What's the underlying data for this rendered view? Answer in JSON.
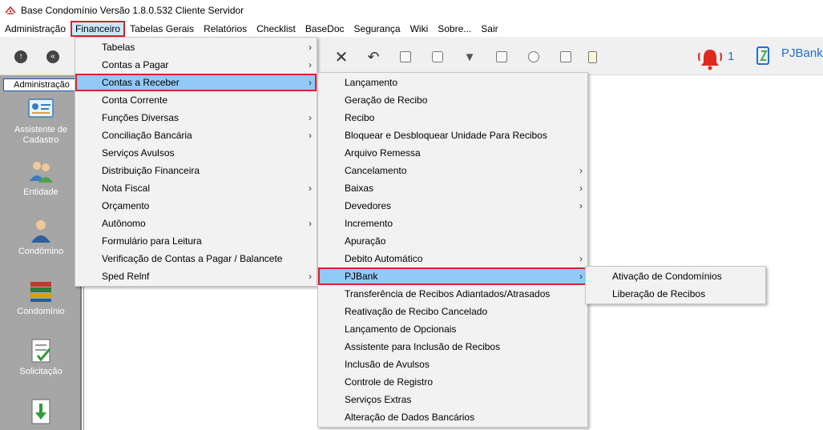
{
  "window": {
    "title": "Base Condomínio Versão 1.8.0.532 Cliente Servidor"
  },
  "menubar": [
    "Administração",
    "Financeiro",
    "Tabelas Gerais",
    "Relatórios",
    "Checklist",
    "BaseDoc",
    "Segurança",
    "Wiki",
    "Sobre...",
    "Sair"
  ],
  "toolbar": {
    "notification_count": "1",
    "pjbank_label": "PJBank",
    "icons": [
      "up-arrow-icon",
      "back-arrow-icon",
      "close-x-icon",
      "undo-icon",
      "save-icon",
      "print-icon",
      "filter-icon",
      "window-icon",
      "search-icon",
      "zoom-icon",
      "notepad-icon",
      "bell-icon",
      "pjbank-logo-icon"
    ],
    "bell_color": "#e0281f",
    "accent_color": "#1f6fd6"
  },
  "sidebar": {
    "tab": "Administração",
    "items": [
      {
        "label": "Assistente de Cadastro",
        "icon": "id-card-icon"
      },
      {
        "label": "Entidade",
        "icon": "people-icon"
      },
      {
        "label": "Condômino",
        "icon": "person-icon"
      },
      {
        "label": "Condomínio",
        "icon": "books-icon"
      },
      {
        "label": "Solicitação",
        "icon": "checklist-icon"
      },
      {
        "label": "",
        "icon": "download-document-icon"
      }
    ]
  },
  "financeiro_menu": [
    {
      "label": "Tabelas",
      "submenu": true
    },
    {
      "label": "Contas a Pagar",
      "submenu": true
    },
    {
      "label": "Contas a Receber",
      "submenu": true,
      "selected": true
    },
    {
      "label": "Conta Corrente",
      "submenu": false
    },
    {
      "label": "Funções Diversas",
      "submenu": true
    },
    {
      "label": "Conciliação Bancária",
      "submenu": true
    },
    {
      "label": "Serviços Avulsos",
      "submenu": false
    },
    {
      "label": "Distribuição Financeira",
      "submenu": false
    },
    {
      "label": "Nota Fiscal",
      "submenu": true
    },
    {
      "label": "Orçamento",
      "submenu": false
    },
    {
      "label": "Autônomo",
      "submenu": true
    },
    {
      "label": "Formulário para Leitura",
      "submenu": false
    },
    {
      "label": "Verificação de Contas a Pagar / Balancete",
      "submenu": false
    },
    {
      "label": "Sped Relnf",
      "submenu": true
    }
  ],
  "contas_receber_menu": [
    {
      "label": "Lançamento",
      "submenu": false
    },
    {
      "label": "Geração de Recibo",
      "submenu": false
    },
    {
      "label": "Recibo",
      "submenu": false
    },
    {
      "label": "Bloquear e Desbloquear Unidade Para Recibos",
      "submenu": false
    },
    {
      "label": "Arquivo Remessa",
      "submenu": false
    },
    {
      "label": "Cancelamento",
      "submenu": true
    },
    {
      "label": "Baixas",
      "submenu": true
    },
    {
      "label": "Devedores",
      "submenu": true
    },
    {
      "label": "Incremento",
      "submenu": false
    },
    {
      "label": "Apuração",
      "submenu": false
    },
    {
      "label": "Debito Automático",
      "submenu": true
    },
    {
      "label": "PJBank",
      "submenu": true,
      "selected": true
    },
    {
      "label": "Transferência de Recibos Adiantados/Atrasados",
      "submenu": false
    },
    {
      "label": "Reativação de Recibo Cancelado",
      "submenu": false
    },
    {
      "label": "Lançamento de Opcionais",
      "submenu": false
    },
    {
      "label": "Assistente para Inclusão de Recibos",
      "submenu": false
    },
    {
      "label": "Inclusão de Avulsos",
      "submenu": false
    },
    {
      "label": "Controle de Registro",
      "submenu": false
    },
    {
      "label": "Serviços Extras",
      "submenu": false
    },
    {
      "label": "Alteração de Dados Bancários",
      "submenu": false
    }
  ],
  "pjbank_menu": [
    {
      "label": "Ativação de Condomínios",
      "submenu": false
    },
    {
      "label": "Liberação de Recibos",
      "submenu": false
    }
  ],
  "highlight_color": "#91c9f7",
  "focus_border_color": "#d9232d"
}
